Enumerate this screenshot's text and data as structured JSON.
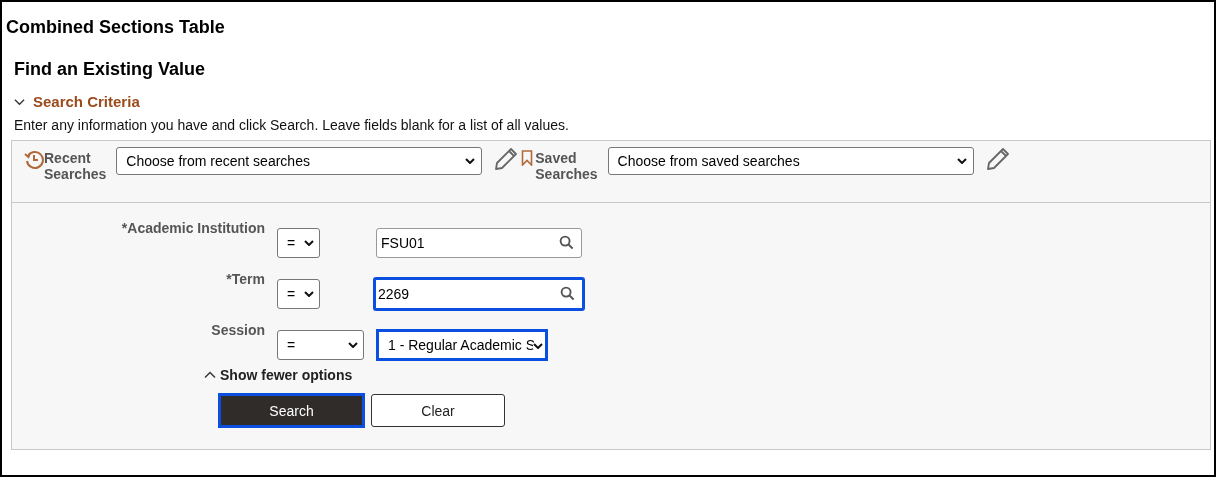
{
  "page_title": "Combined Sections Table",
  "heading": "Find an Existing Value",
  "section": {
    "title": "Search Criteria",
    "expanded": true
  },
  "instructions": "Enter any information you have and click Search. Leave fields blank for a list of all values.",
  "recent_searches": {
    "label_lines": [
      "Recent",
      "Searches"
    ],
    "value": "Choose from recent searches"
  },
  "saved_searches": {
    "label_lines": [
      "Saved",
      "Searches"
    ],
    "value": "Choose from saved searches"
  },
  "fields": [
    {
      "kind": "lookup",
      "label": "*Academic Institution",
      "operator": "=",
      "value": "FSU01",
      "highlighted": false
    },
    {
      "kind": "lookup",
      "label": "*Term",
      "operator": "=",
      "value": "2269",
      "highlighted": true
    },
    {
      "kind": "select",
      "label": "Session",
      "operator": "=",
      "value": "1 - Regular Academic S",
      "highlighted": true
    }
  ],
  "options_toggle": {
    "label": "Show fewer options",
    "expanded": true
  },
  "buttons": [
    {
      "label": "Search",
      "kind": "primary",
      "highlighted": true
    },
    {
      "label": "Clear",
      "kind": "secondary",
      "highlighted": false
    }
  ]
}
